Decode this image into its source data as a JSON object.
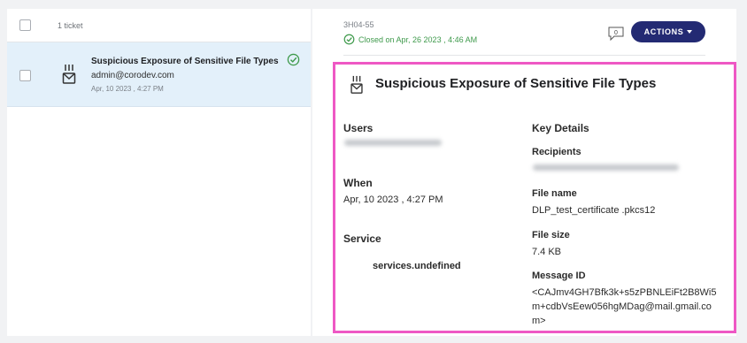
{
  "ticket_list": {
    "count_label": "1 ticket",
    "items": [
      {
        "title": "Suspicious Exposure of Sensitive File Types",
        "email": "admin@corodev.com",
        "date": "Apr, 10 2023 , 4:27 PM",
        "status_icon": "check-circle-icon"
      }
    ]
  },
  "detail": {
    "ticket_id": "3H04-55",
    "closed_text": "Closed on Apr, 26 2023 , 4:46 AM",
    "comment_count": "0",
    "actions_label": "ACTIONS",
    "title": "Suspicious Exposure of Sensitive File Types",
    "users_label": "Users",
    "when_label": "When",
    "when_value": "Apr, 10 2023 , 4:27 PM",
    "service_label": "Service",
    "service_value": "services.undefined",
    "key_details_label": "Key Details",
    "recipients_label": "Recipients",
    "file_name_label": "File name",
    "file_name_value": "DLP_test_certificate .pkcs12",
    "file_size_label": "File size",
    "file_size_value": "7.4 KB",
    "message_id_label": "Message ID",
    "message_id_value": "<CAJmv4GH7Bfk3k+s5zPBNLEiFt2B8Wi5m+cdbVsEew056hgMDag@mail.gmail.com>"
  },
  "colors": {
    "accent": "#232a73",
    "selected_row": "#e3f0fa",
    "success": "#3f9a4c",
    "highlight_border": "#ee58c4"
  }
}
